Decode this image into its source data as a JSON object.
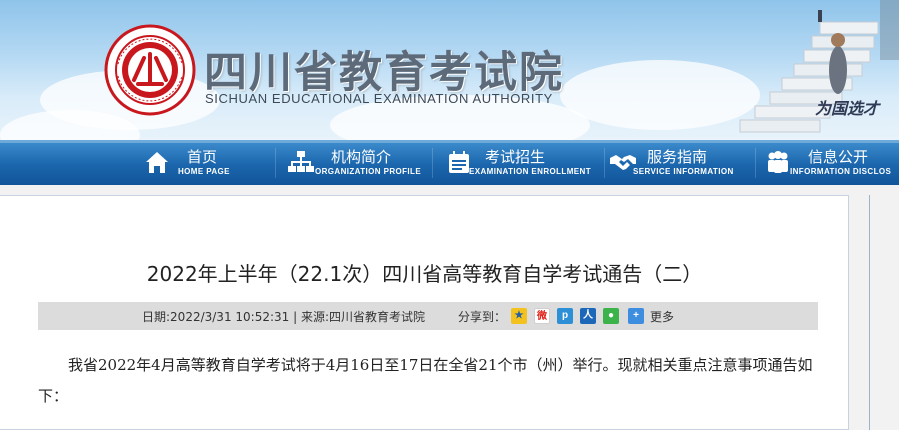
{
  "header": {
    "site_title": "四川省教育考试院",
    "site_subtitle": "SICHUAN EDUCATIONAL EXAMINATION AUTHORITY",
    "slogan": "为国选才",
    "logo_icon": "exam-authority-emblem-icon",
    "colors": {
      "emblem_red": "#c8181e",
      "title_gray": "#5d6a7a",
      "sky": "#a9d3f1"
    }
  },
  "nav": {
    "items": [
      {
        "label": "首页",
        "sublabel": "HOME PAGE",
        "icon": "home-icon"
      },
      {
        "label": "机构简介",
        "sublabel": "ORGANIZATION PROFILE",
        "icon": "org-chart-icon"
      },
      {
        "label": "考试招生",
        "sublabel": "EXAMINATION ENROLLMENT",
        "icon": "calendar-icon"
      },
      {
        "label": "服务指南",
        "sublabel": "SERVICE INFORMATION",
        "icon": "handshake-icon"
      },
      {
        "label": "信息公开",
        "sublabel": "INFORMATION DISCLOS",
        "icon": "people-icon"
      }
    ],
    "colors": {
      "bar": "#1b66ad"
    }
  },
  "article": {
    "title": "2022年上半年（22.1次）四川省高等教育自学考试通告（二）",
    "meta": "日期:2022/3/31 10:52:31 | 来源:四川省教育考试院",
    "share_label": "分享到：",
    "share_icons": [
      "qzone-icon",
      "weibo-icon",
      "tencent-weibo-icon",
      "renren-icon",
      "wechat-icon",
      "more-plus-icon"
    ],
    "share_more": "更多",
    "body": "我省2022年4月高等教育自学考试将于4月16日至17日在全省21个市（州）举行。现就相关重点注意事项通告如下："
  }
}
